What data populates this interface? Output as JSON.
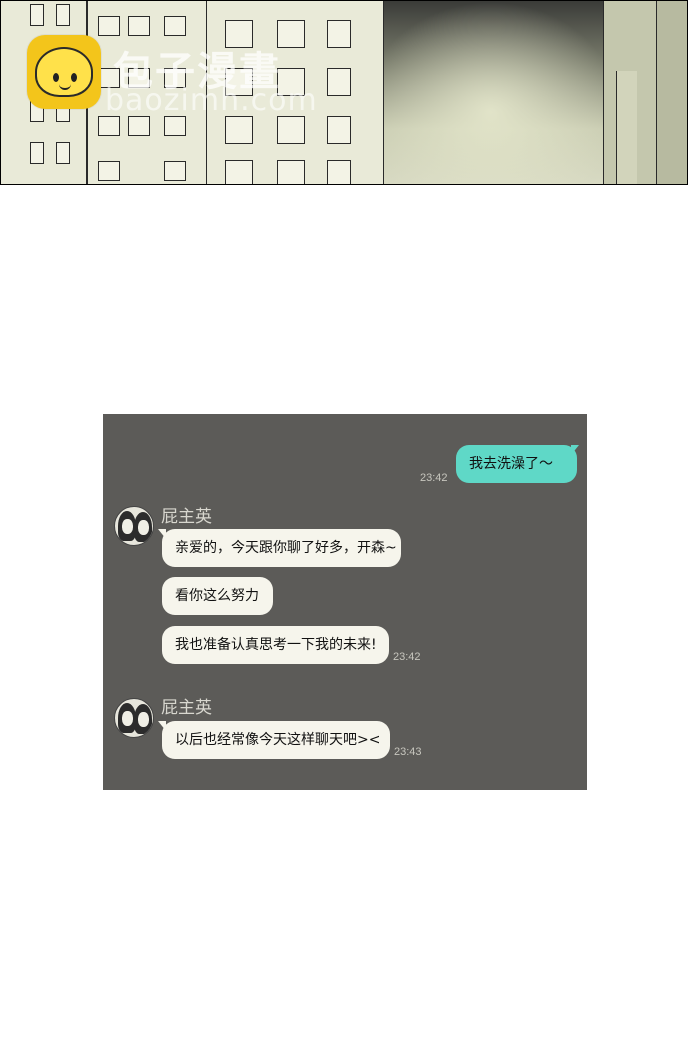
{
  "watermark": {
    "logo_icon": "baozi-bun-icon",
    "title": "包子漫畫",
    "subtitle": "baozimh.com",
    "logo_color": "#f3c51b"
  },
  "chat": {
    "background": "#5c5b58",
    "outgoing_color": "#5fd8c7",
    "incoming_color": "#f6f5ec",
    "messages": [
      {
        "side": "out",
        "text": "我去洗澡了～",
        "time": "23:42"
      },
      {
        "side": "in",
        "sender": "屁主英",
        "text": "亲爱的，今天跟你聊了好多，开森~"
      },
      {
        "side": "in",
        "text": "看你这么努力"
      },
      {
        "side": "in",
        "text": "我也准备认真思考一下我的未来!",
        "time": "23:42"
      },
      {
        "side": "in",
        "sender": "屁主英",
        "text": "以后也经常像今天这样聊天吧><",
        "time": "23:43"
      }
    ]
  }
}
